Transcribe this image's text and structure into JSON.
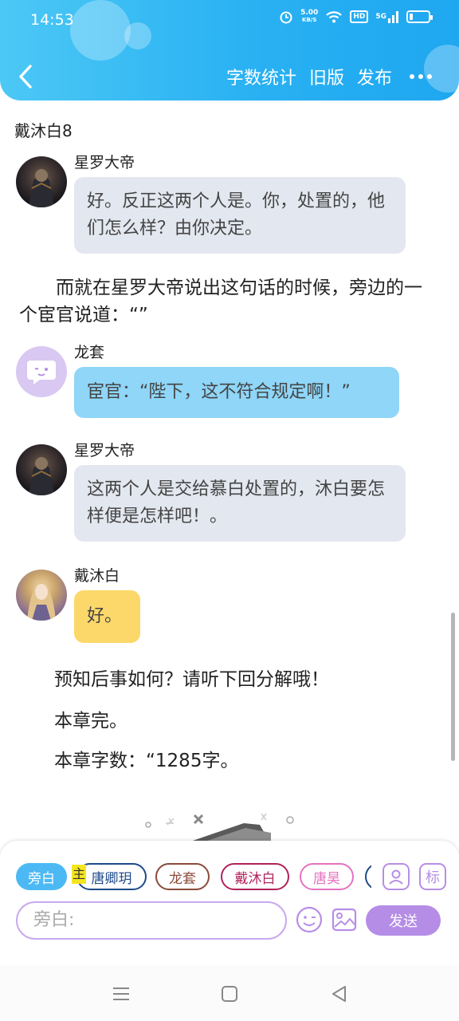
{
  "status_bar": {
    "time": "14:53",
    "speed_value": "5.00",
    "speed_unit": "KB/S",
    "hd": "HD",
    "net": "5G"
  },
  "header": {
    "actions": [
      "字数统计",
      "旧版",
      "发布"
    ],
    "background": "#29b1f3"
  },
  "chapter": {
    "title": "戴沐白8"
  },
  "messages": [
    {
      "name": "星罗大帝",
      "text": "好。反正这两个人是。你，处置的，他们怎么样？由你决定。"
    },
    {
      "name": "龙套",
      "text": "宦官：“陛下，这不符合规定啊！”"
    },
    {
      "name": "星罗大帝",
      "text": "这两个人是交给慕白处置的，沐白要怎样便是怎样吧！。"
    },
    {
      "name": "戴沐白",
      "text": "好。"
    }
  ],
  "narration": "而就在星罗大帝说出这句话的时候，旁边的一个宦官说道：“”",
  "endings": [
    "预知后事如何？请听下回分解哦！",
    "本章完。",
    "本章字数：“1285字。"
  ],
  "panel": {
    "chips": [
      "旁白",
      "唐卿玥",
      "龙套",
      "戴沐白",
      "唐昊"
    ],
    "main_tag": "主",
    "tag_button": "标",
    "input_placeholder": "旁白:",
    "send_label": "发送"
  },
  "colors": {
    "accent": "#b58de6",
    "chip_active": "#4cb9f5",
    "bubble_gray": "#e3e7ef",
    "bubble_blue": "#8fd6f8",
    "bubble_yellow": "#fcd86a"
  }
}
